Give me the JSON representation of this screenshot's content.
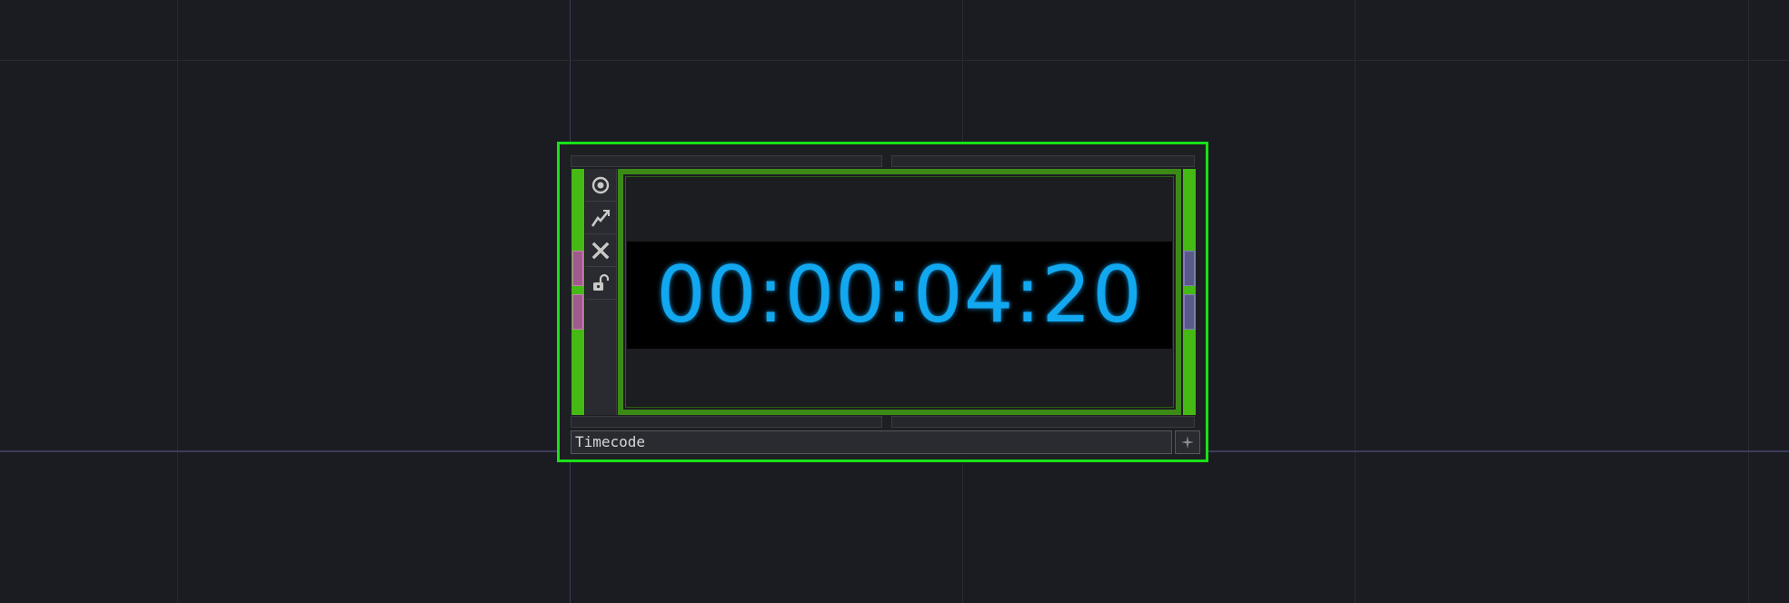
{
  "node": {
    "name": "Timecode",
    "display_value": "00:00:04:20"
  },
  "toolbar": {
    "items": [
      {
        "icon": "viewer-active-icon"
      },
      {
        "icon": "bypass-icon"
      },
      {
        "icon": "close-icon"
      },
      {
        "icon": "lock-icon"
      }
    ]
  },
  "colors": {
    "selection": "#18e018",
    "node_strip": "#45b914",
    "timecode": "#11a8f0",
    "background": "#1b1c21"
  }
}
